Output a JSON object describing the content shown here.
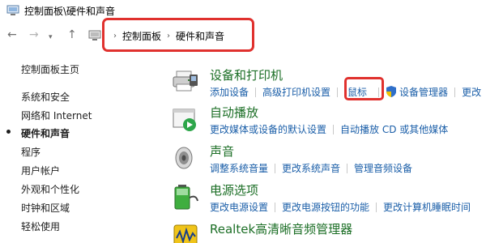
{
  "window": {
    "title": "控制面板\\硬件和声音"
  },
  "address_bar": {
    "crumbs": [
      "控制面板",
      "硬件和声音"
    ]
  },
  "sidebar": {
    "items": [
      {
        "label": "控制面板主页",
        "active": false
      },
      {
        "label": "系统和安全",
        "active": false
      },
      {
        "label": "网络和 Internet",
        "active": false
      },
      {
        "label": "硬件和声音",
        "active": true
      },
      {
        "label": "程序",
        "active": false
      },
      {
        "label": "用户帐户",
        "active": false
      },
      {
        "label": "外观和个性化",
        "active": false
      },
      {
        "label": "时钟和区域",
        "active": false
      },
      {
        "label": "轻松使用",
        "active": false
      }
    ]
  },
  "categories": [
    {
      "title": "设备和打印机",
      "icon": "printer-icon",
      "links": [
        "添加设备",
        "高级打印机设置",
        "鼠标",
        "设备管理器",
        "更改"
      ]
    },
    {
      "title": "自动播放",
      "icon": "autoplay-icon",
      "links": [
        "更改媒体或设备的默认设置",
        "自动播放 CD 或其他媒体"
      ]
    },
    {
      "title": "声音",
      "icon": "speaker-icon",
      "links": [
        "调整系统音量",
        "更改系统声音",
        "管理音频设备"
      ]
    },
    {
      "title": "电源选项",
      "icon": "battery-icon",
      "links": [
        "更改电源设置",
        "更改电源按钮的功能",
        "更改计算机睡眠时间"
      ]
    },
    {
      "title": "Realtek高清晰音频管理器",
      "icon": "realtek-icon",
      "links": []
    }
  ],
  "colors": {
    "category_title": "#1b6e25",
    "link": "#1a5ea8",
    "highlight": "#e0312e"
  }
}
